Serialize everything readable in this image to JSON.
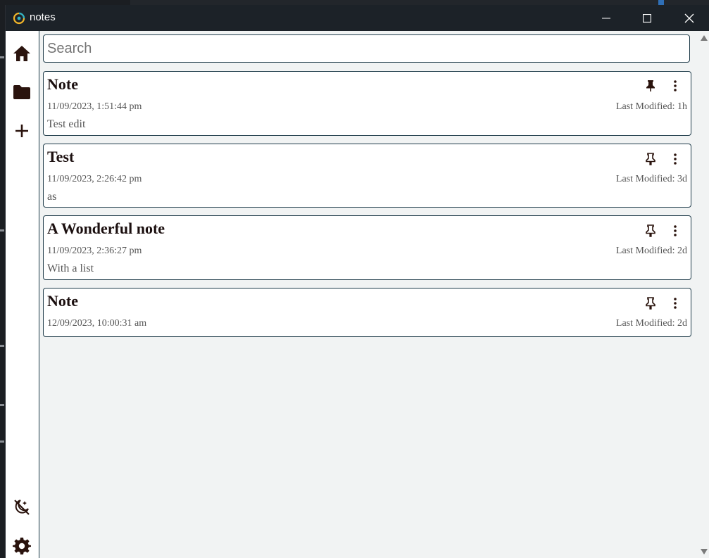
{
  "window": {
    "title": "notes"
  },
  "search": {
    "placeholder": "Search",
    "value": ""
  },
  "sidebar": {
    "top_items": [
      {
        "icon": "home-icon"
      },
      {
        "icon": "folder-icon"
      },
      {
        "icon": "plus-icon"
      }
    ],
    "bottom_items": [
      {
        "icon": "theme-toggle-icon"
      },
      {
        "icon": "gear-icon"
      }
    ]
  },
  "notes": [
    {
      "title": "Note",
      "created": "11/09/2023, 1:51:44 pm",
      "modified": "Last Modified: 1h",
      "preview": "Test edit",
      "pinned": true
    },
    {
      "title": "Test",
      "created": "11/09/2023, 2:26:42 pm",
      "modified": "Last Modified: 3d",
      "preview": "as",
      "pinned": false
    },
    {
      "title": "A Wonderful note",
      "created": "11/09/2023, 2:36:27 pm",
      "modified": "Last Modified: 2d",
      "preview": "With a list",
      "pinned": false
    },
    {
      "title": "Note",
      "created": "12/09/2023, 10:00:31 am",
      "modified": "Last Modified: 2d",
      "preview": "",
      "pinned": false
    }
  ],
  "colors": {
    "titlebar": "#1c2228",
    "accent_border": "#1f3c4a",
    "content_bg": "#f1f3f3",
    "icon": "#2a130d"
  }
}
